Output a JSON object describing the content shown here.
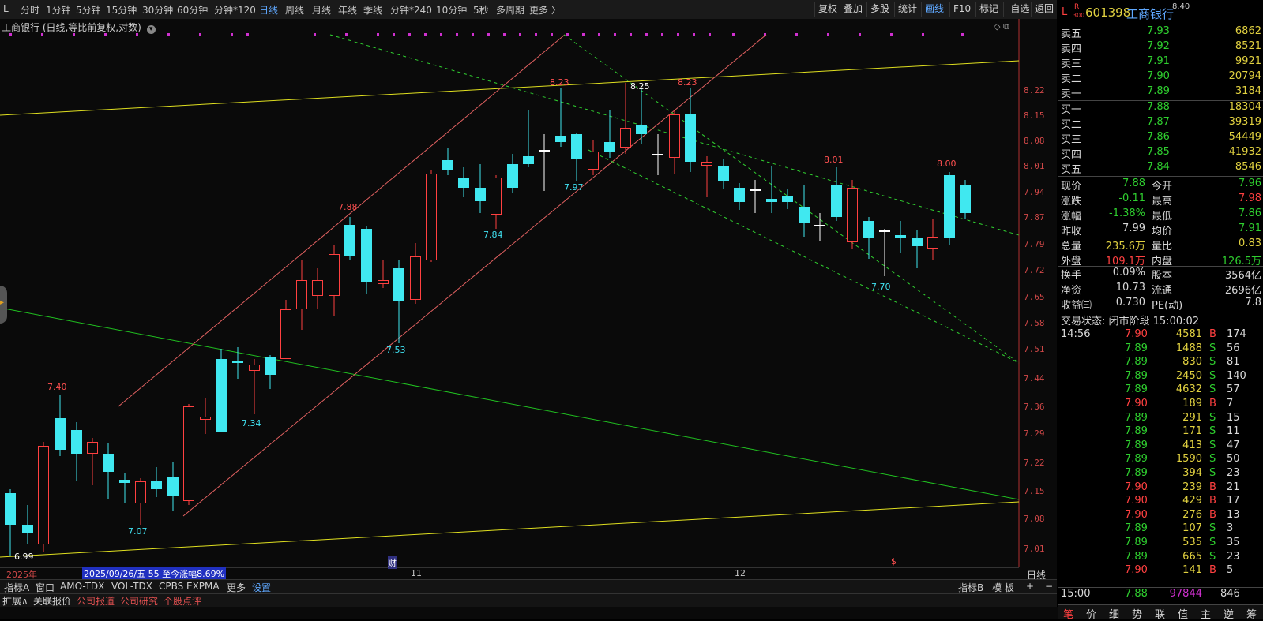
{
  "toolbar": {
    "timeframes": [
      "分时",
      "1分钟",
      "5分钟",
      "15分钟",
      "30分钟",
      "60分钟",
      "分钟*120",
      "日线",
      "周线",
      "月线",
      "年线",
      "季线",
      "分钟*240",
      "10分钟",
      "5秒",
      "多周期",
      "更多 〉"
    ],
    "active_timeframe": "日线",
    "right_buttons": [
      "复权",
      "叠加",
      "多股",
      "统计",
      "画线",
      "F10",
      "标记",
      "-自选",
      "返回"
    ],
    "active_right": "画线"
  },
  "chart": {
    "title": "工商银行 (日线,等比前复权,对数)",
    "y_ticks": [
      "8.22",
      "8.15",
      "8.08",
      "8.01",
      "7.94",
      "7.87",
      "7.79",
      "7.72",
      "7.65",
      "7.58",
      "7.51",
      "7.44",
      "7.36",
      "7.29",
      "7.22",
      "7.15",
      "7.08",
      "7.01"
    ],
    "annotations_high": [
      "7.40",
      "7.88",
      "8.23",
      "8.23",
      "8.01",
      "8.00"
    ],
    "annotations_low": [
      "7.07",
      "7.34",
      "7.53",
      "7.84",
      "7.97",
      "7.70"
    ],
    "annotation_peak": "8.25",
    "annotation_bottom": "6.99",
    "x_labels": [
      "2025年",
      "11",
      "12"
    ],
    "date_label": "2025/09/26/五 55 至今涨幅8.69%",
    "cai_marker": "财",
    "s_marker": "$",
    "period_label": "日线",
    "colors": {
      "up": "#ff4040",
      "down": "#40e8f0",
      "yellow_line": "#e0e020",
      "green_line": "#20c020",
      "channel_line": "#e06060",
      "dash_line": "#30d030"
    }
  },
  "bottom1": {
    "tabs": [
      "指标A",
      "窗口",
      "AMO-TDX",
      "VOL-TDX",
      "CPBS",
      "EXPMA",
      "更多",
      "设置"
    ],
    "active": "设置",
    "right": [
      "指标B",
      "模 板",
      "+",
      "−"
    ]
  },
  "bottom2": {
    "tabs": [
      "扩展∧",
      "关联报价",
      "公司报道",
      "公司研究",
      "个股点评"
    ]
  },
  "quote": {
    "header_l": "L",
    "header_badge_r": "R",
    "header_badge_num": "300",
    "code": "601398",
    "name": "工商银行",
    "header_extra": "8.40",
    "sells": [
      {
        "label": "卖五",
        "price": "7.93",
        "vol": "6862"
      },
      {
        "label": "卖四",
        "price": "7.92",
        "vol": "8521"
      },
      {
        "label": "卖三",
        "price": "7.91",
        "vol": "9921"
      },
      {
        "label": "卖二",
        "price": "7.90",
        "vol": "20794"
      },
      {
        "label": "卖一",
        "price": "7.89",
        "vol": "3184"
      }
    ],
    "buys": [
      {
        "label": "买一",
        "price": "7.88",
        "vol": "18304"
      },
      {
        "label": "买二",
        "price": "7.87",
        "vol": "39319"
      },
      {
        "label": "买三",
        "price": "7.86",
        "vol": "54449"
      },
      {
        "label": "买四",
        "price": "7.85",
        "vol": "41932"
      },
      {
        "label": "买五",
        "price": "7.84",
        "vol": "8546"
      }
    ],
    "stats": [
      {
        "l1": "现价",
        "v1": "7.88",
        "l2": "今开",
        "v2": "7.96"
      },
      {
        "l1": "涨跌",
        "v1": "-0.11",
        "l2": "最高",
        "v2": "7.98"
      },
      {
        "l1": "涨幅",
        "v1": "-1.38%",
        "l2": "最低",
        "v2": "7.86"
      },
      {
        "l1": "昨收",
        "v1": "7.99",
        "l2": "均价",
        "v2": "7.91"
      },
      {
        "l1": "总量",
        "v1": "235.6万",
        "l2": "量比",
        "v2": "0.83"
      },
      {
        "l1": "外盘",
        "v1": "109.1万",
        "l2": "内盘",
        "v2": "126.5万"
      }
    ],
    "stats2": [
      {
        "l1": "换手",
        "v1": "0.09%",
        "l2": "股本",
        "v2": "3564亿"
      },
      {
        "l1": "净资",
        "v1": "10.73",
        "l2": "流通",
        "v2": "2696亿"
      },
      {
        "l1": "收益㈢",
        "v1": "0.730",
        "l2": "PE(动)",
        "v2": "7.8"
      }
    ],
    "trade_state": "交易状态: 闭市阶段 15:00:02",
    "ticks_time": "14:56",
    "ticks": [
      {
        "p": "7.90",
        "v": "4581",
        "s": "B",
        "n": "174"
      },
      {
        "p": "7.89",
        "v": "1488",
        "s": "S",
        "n": "56"
      },
      {
        "p": "7.89",
        "v": "830",
        "s": "S",
        "n": "81"
      },
      {
        "p": "7.89",
        "v": "2450",
        "s": "S",
        "n": "140"
      },
      {
        "p": "7.89",
        "v": "4632",
        "s": "S",
        "n": "57"
      },
      {
        "p": "7.90",
        "v": "189",
        "s": "B",
        "n": "7"
      },
      {
        "p": "7.89",
        "v": "291",
        "s": "S",
        "n": "15"
      },
      {
        "p": "7.89",
        "v": "171",
        "s": "S",
        "n": "11"
      },
      {
        "p": "7.89",
        "v": "413",
        "s": "S",
        "n": "47"
      },
      {
        "p": "7.89",
        "v": "1590",
        "s": "S",
        "n": "50"
      },
      {
        "p": "7.89",
        "v": "394",
        "s": "S",
        "n": "23"
      },
      {
        "p": "7.90",
        "v": "239",
        "s": "B",
        "n": "21"
      },
      {
        "p": "7.90",
        "v": "429",
        "s": "B",
        "n": "17"
      },
      {
        "p": "7.90",
        "v": "276",
        "s": "B",
        "n": "13"
      },
      {
        "p": "7.89",
        "v": "107",
        "s": "S",
        "n": "3"
      },
      {
        "p": "7.89",
        "v": "535",
        "s": "S",
        "n": "35"
      },
      {
        "p": "7.89",
        "v": "665",
        "s": "S",
        "n": "23"
      },
      {
        "p": "7.90",
        "v": "141",
        "s": "B",
        "n": "5"
      }
    ],
    "last_time": "15:00",
    "last_price": "7.88",
    "last_vol": "97844",
    "last_n": "846",
    "bottom_tabs": [
      "笔",
      "价",
      "细",
      "势",
      "联",
      "值",
      "主",
      "逆",
      "筹"
    ]
  }
}
